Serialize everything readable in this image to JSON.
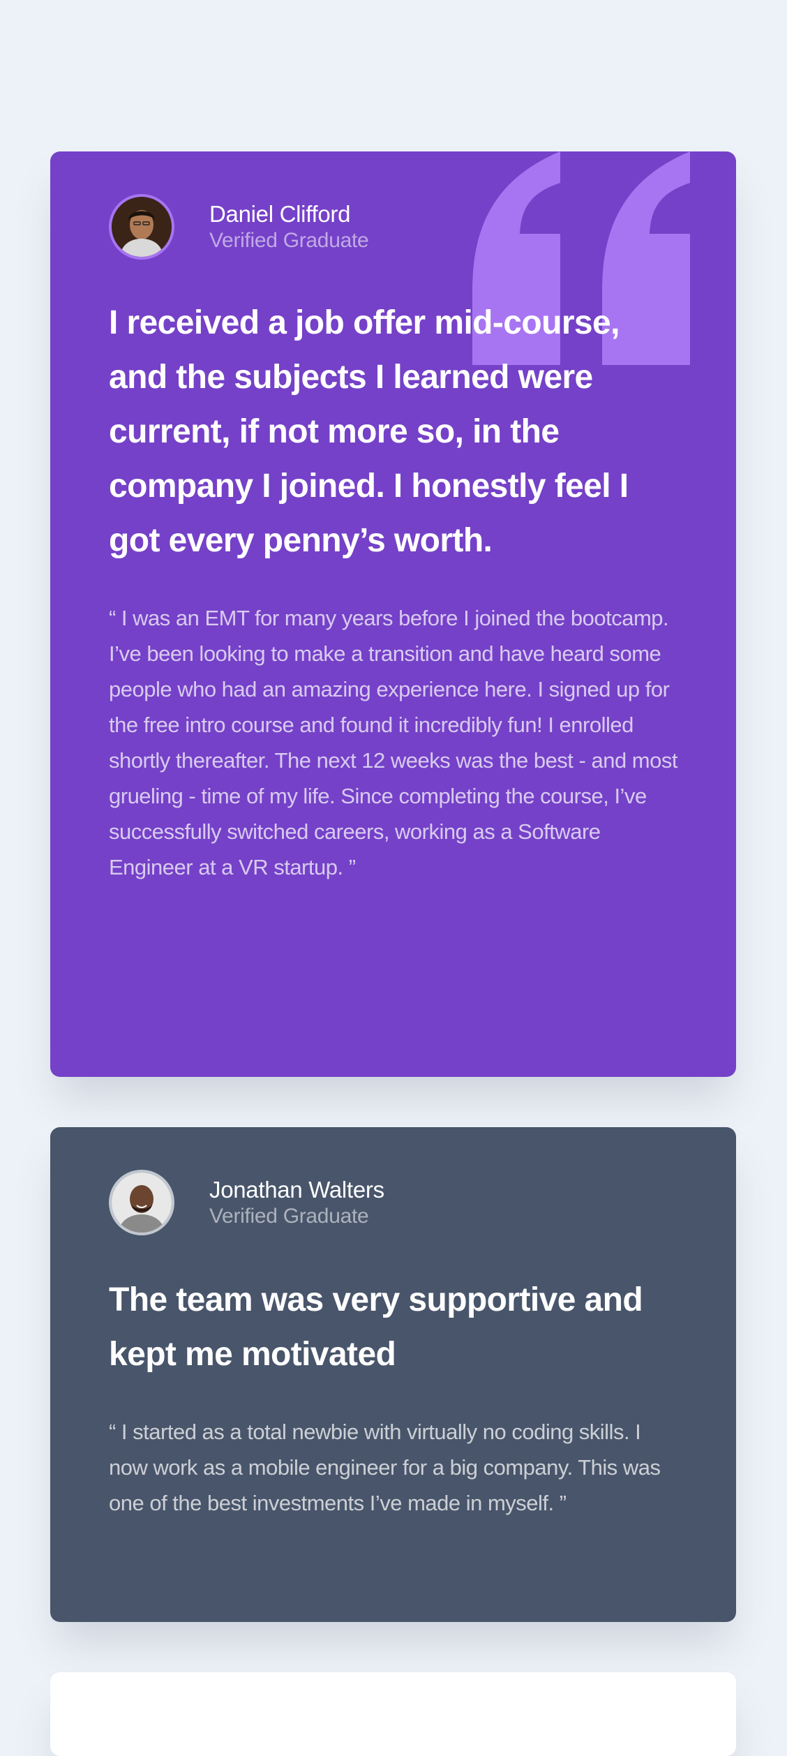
{
  "testimonials": [
    {
      "name": "Daniel Clifford",
      "status": "Verified Graduate",
      "headline": "I received a job offer mid-course, and the subjects I learned were current, if not more so, in the company I joined. I honestly feel I got every penny’s worth.",
      "quote": "“ I was an EMT for many years before I joined the bootcamp. I’ve been looking to make a transition and have heard some people who had an amazing experience here. I signed up for the free intro course and found it incredibly fun! I enrolled shortly thereafter. The next 12 weeks was the best - and most grueling - time of my life. Since completing the course, I’ve successfully switched careers, working as a Software Engineer at a VR startup. ”",
      "card_color": "#7541c8",
      "icon": "quotation-mark-icon"
    },
    {
      "name": "Jonathan Walters",
      "status": "Verified Graduate",
      "headline": "The team was very supportive and kept me motivated",
      "quote": "“ I started as a total newbie with virtually no coding skills. I now work as a mobile engineer for a big company. This was one of the best investments I’ve made in myself. ”",
      "card_color": "#48556a"
    }
  ],
  "colors": {
    "page_background": "#edf2f8",
    "quote_mark": "#a775f1",
    "third_card": "#ffffff"
  }
}
